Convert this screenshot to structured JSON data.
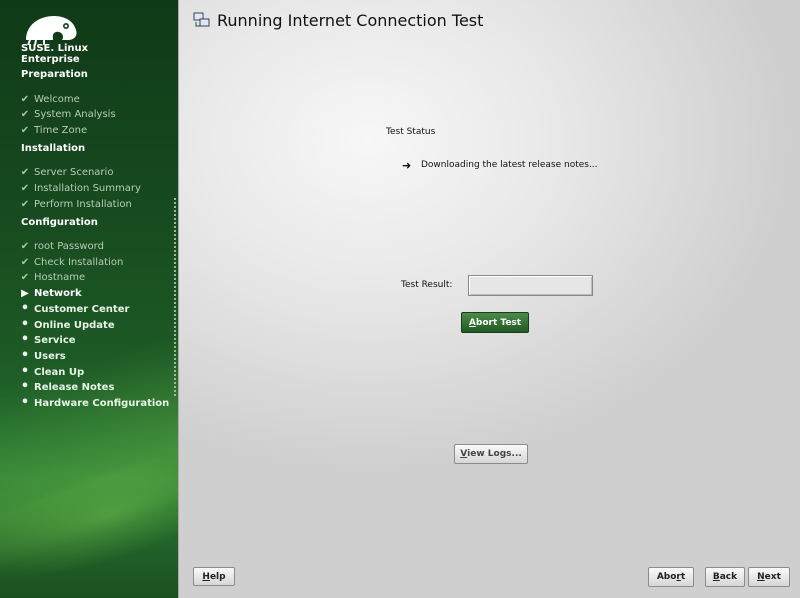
{
  "brand": {
    "line1": "SUSE. Linux",
    "line2": "Enterprise"
  },
  "sidebar": {
    "sections": [
      {
        "title": "Preparation"
      },
      {
        "title": "Installation"
      },
      {
        "title": "Configuration"
      }
    ],
    "preparation": [
      {
        "label": "Welcome",
        "state": "done"
      },
      {
        "label": "System Analysis",
        "state": "done"
      },
      {
        "label": "Time Zone",
        "state": "done"
      }
    ],
    "installation": [
      {
        "label": "Server Scenario",
        "state": "done"
      },
      {
        "label": "Installation Summary",
        "state": "done"
      },
      {
        "label": "Perform Installation",
        "state": "done"
      }
    ],
    "configuration": [
      {
        "label": "root Password",
        "state": "done"
      },
      {
        "label": "Check Installation",
        "state": "done"
      },
      {
        "label": "Hostname",
        "state": "done"
      },
      {
        "label": "Network",
        "state": "current"
      },
      {
        "label": "Customer Center",
        "state": "pending"
      },
      {
        "label": "Online Update",
        "state": "pending"
      },
      {
        "label": "Service",
        "state": "pending"
      },
      {
        "label": "Users",
        "state": "pending"
      },
      {
        "label": "Clean Up",
        "state": "pending"
      },
      {
        "label": "Release Notes",
        "state": "pending"
      },
      {
        "label": "Hardware Configuration",
        "state": "pending"
      }
    ]
  },
  "main": {
    "title": "Running Internet Connection Test",
    "test_status_label": "Test Status",
    "status_arrow": "➜",
    "status_text": "Downloading the latest release notes...",
    "result_label": "Test Result:",
    "result_value": ""
  },
  "buttons": {
    "abort_test": {
      "prefix": "",
      "accel": "A",
      "rest": "bort Test"
    },
    "view_logs": {
      "prefix": "",
      "accel": "V",
      "rest": "iew Logs..."
    },
    "help": {
      "prefix": "",
      "accel": "H",
      "rest": "elp"
    },
    "abort": {
      "prefix": "Abo",
      "accel": "r",
      "rest": "t"
    },
    "back": {
      "prefix": "",
      "accel": "B",
      "rest": "ack"
    },
    "next": {
      "prefix": "",
      "accel": "N",
      "rest": "ext"
    }
  },
  "colors": {
    "sidebar_dark": "#0f3a17",
    "sidebar_light": "#2a7a33",
    "accent_button": "#1f5a22"
  },
  "icons": {
    "done": "check-icon",
    "current": "triangle-right-icon",
    "pending": "bullet-icon"
  }
}
